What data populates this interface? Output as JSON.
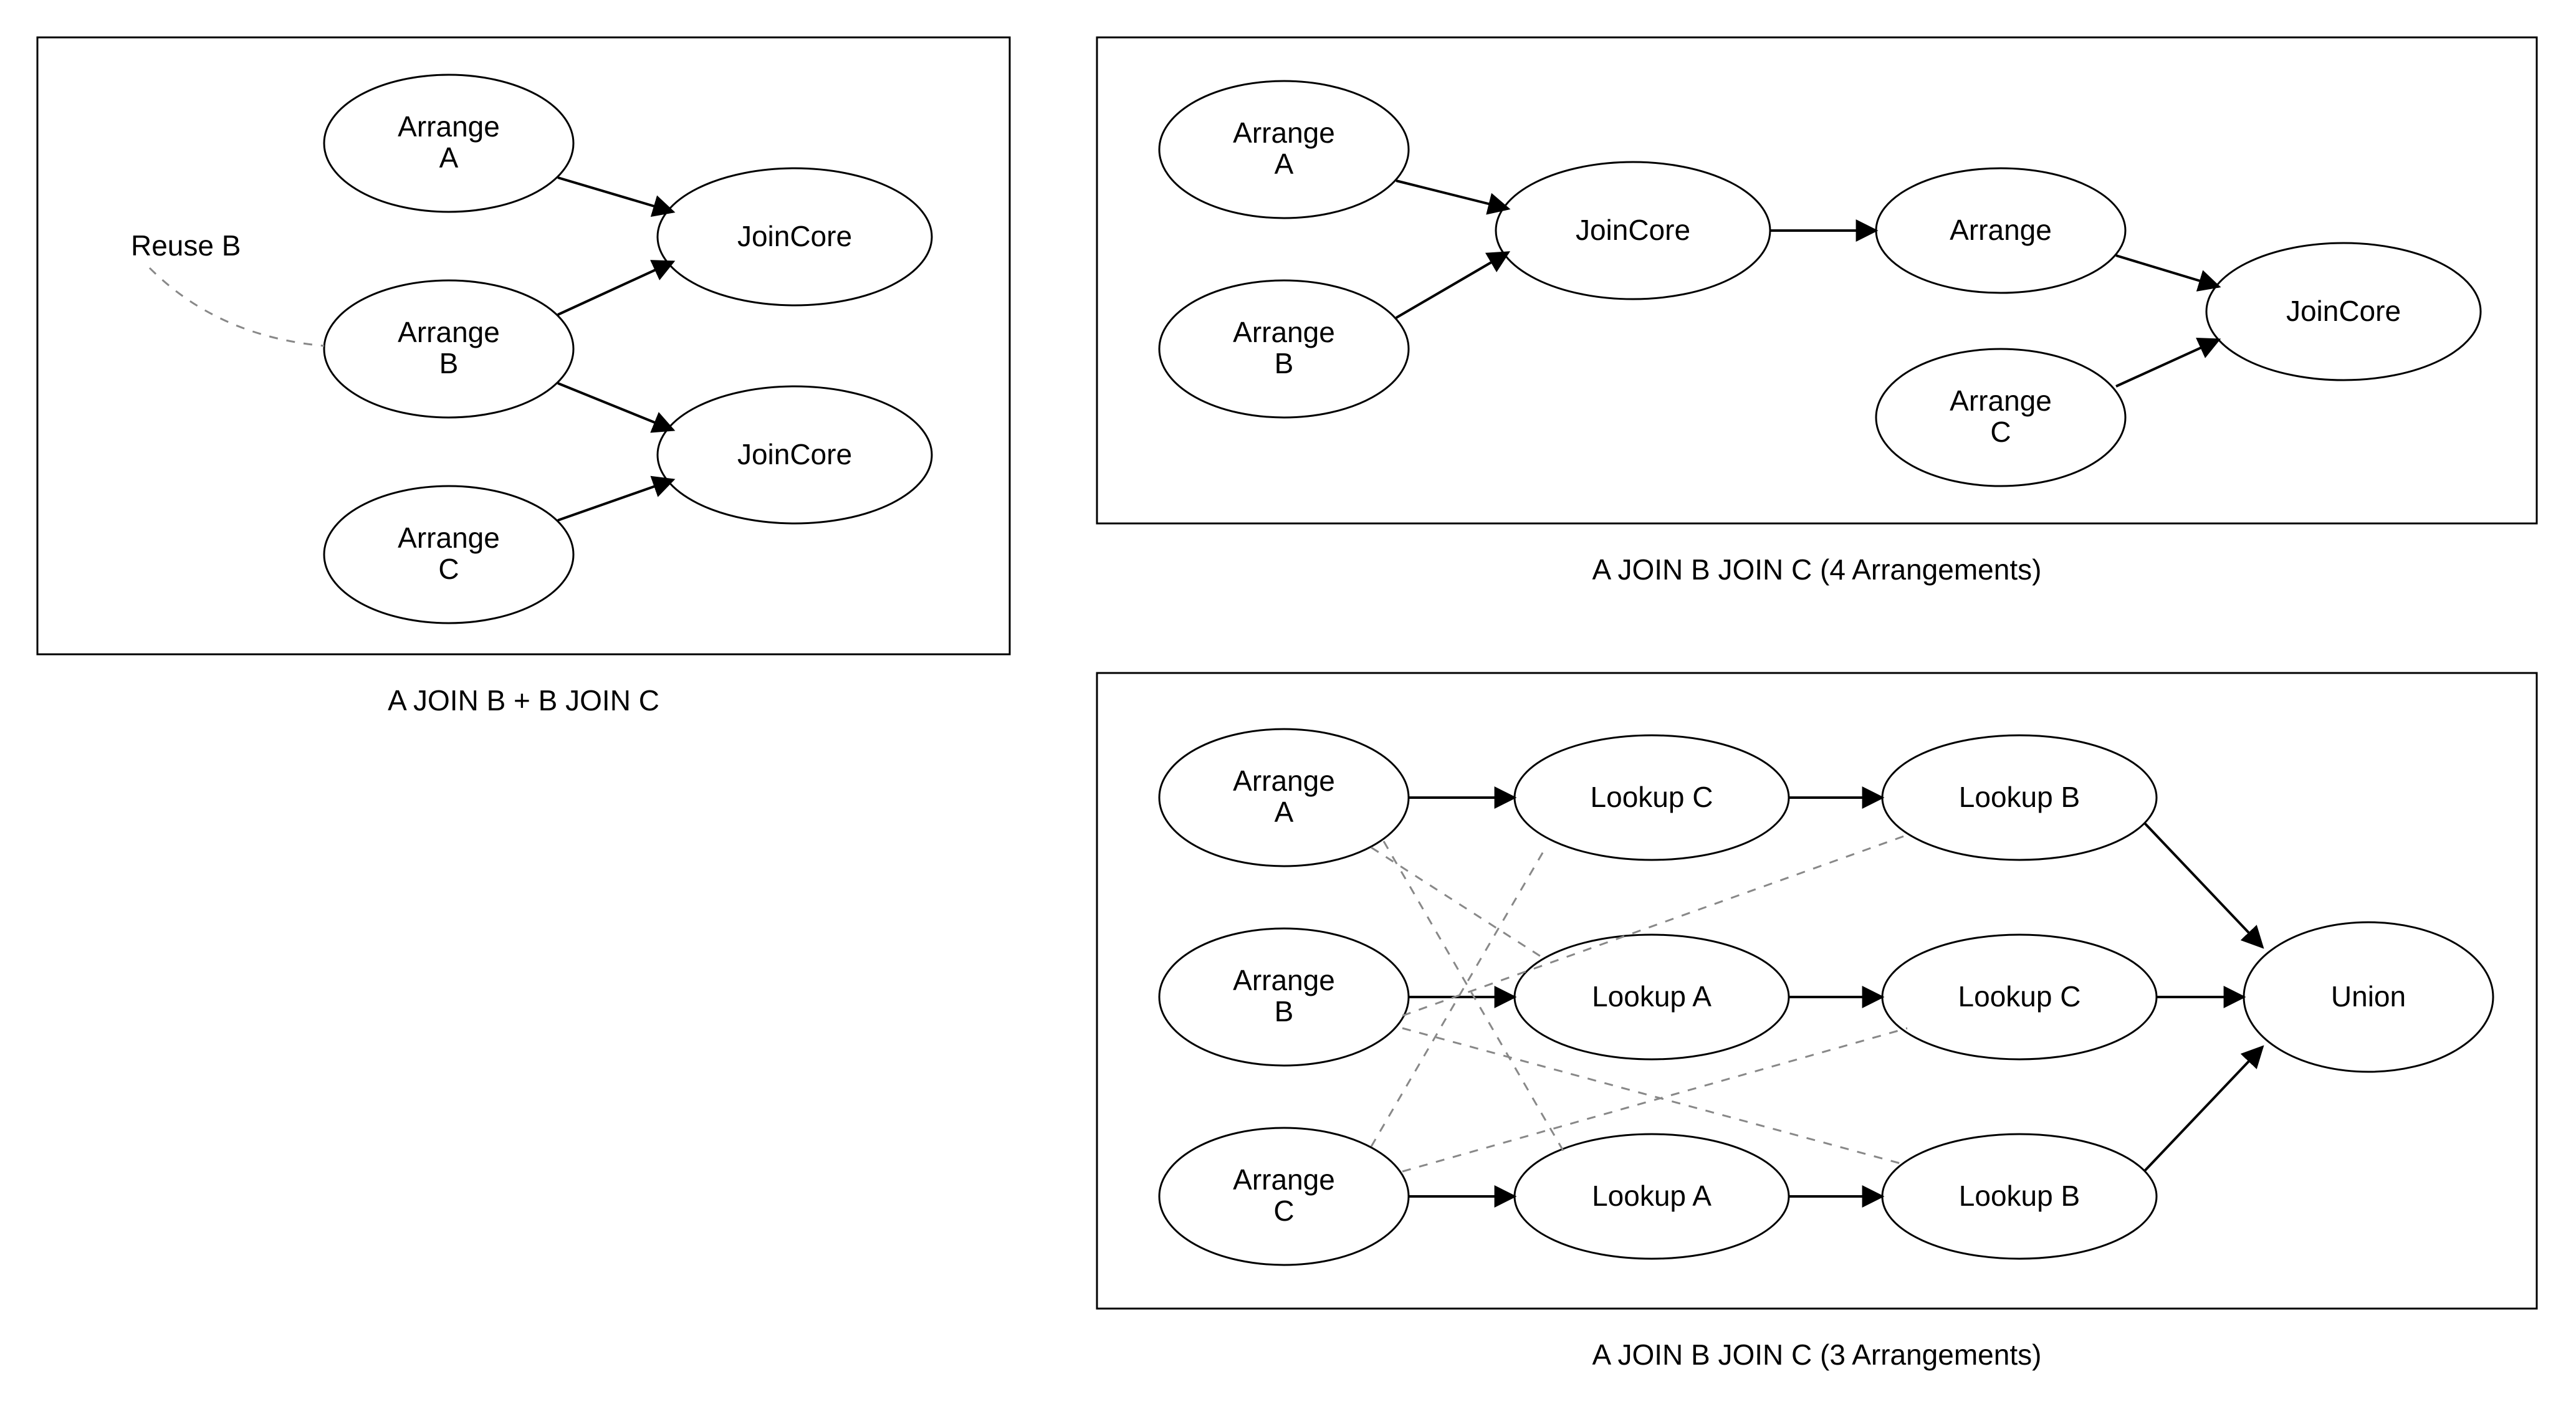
{
  "diagrams": {
    "left": {
      "caption": "A JOIN B + B JOIN C",
      "reuse_label": "Reuse B",
      "nodes": {
        "arrangeA": "Arrange\nA",
        "arrangeB": "Arrange\nB",
        "arrangeC": "Arrange\nC",
        "join1": "JoinCore",
        "join2": "JoinCore"
      }
    },
    "topRight": {
      "caption": "A JOIN B JOIN C (4 Arrangements)",
      "nodes": {
        "arrangeA": "Arrange\nA",
        "arrangeB": "Arrange\nB",
        "join1": "JoinCore",
        "arrange": "Arrange",
        "arrangeC": "Arrange\nC",
        "join2": "JoinCore"
      }
    },
    "bottomRight": {
      "caption": "A JOIN B JOIN C (3 Arrangements)",
      "nodes": {
        "arrangeA": "Arrange\nA",
        "arrangeB": "Arrange\nB",
        "arrangeC": "Arrange\nC",
        "lookupC1": "Lookup C",
        "lookupA2": "Lookup A",
        "lookupA3": "Lookup A",
        "lookupB1": "Lookup B",
        "lookupC2": "Lookup C",
        "lookupB3": "Lookup B",
        "union": "Union"
      }
    }
  }
}
